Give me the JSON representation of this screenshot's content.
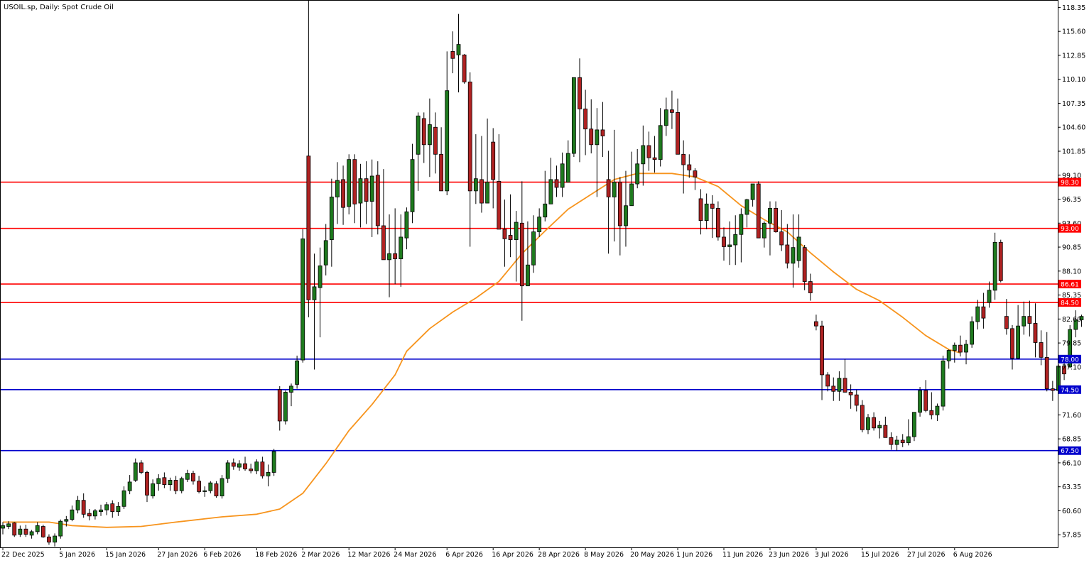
{
  "chart_title": "USOIL.sp, Daily:  Spot Crude Oil",
  "chart_data": {
    "type": "candlestick",
    "title": "USOIL.sp, Daily:  Spot Crude Oil",
    "xlabel": "",
    "ylabel": "",
    "ylim": [
      56.4,
      119.2
    ],
    "y_ticks": [
      "118.35",
      "115.60",
      "112.85",
      "110.10",
      "107.35",
      "104.60",
      "101.85",
      "99.10",
      "96.35",
      "93.60",
      "90.85",
      "88.10",
      "85.35",
      "82.60",
      "79.85",
      "77.10",
      "74.35",
      "71.60",
      "68.85",
      "66.10",
      "63.35",
      "60.60",
      "57.85"
    ],
    "x_ticks": [
      {
        "label": "22 Dec 2025",
        "index": 0
      },
      {
        "label": "5 Jan 2026",
        "index": 10
      },
      {
        "label": "15 Jan 2026",
        "index": 18
      },
      {
        "label": "27 Jan 2026",
        "index": 27
      },
      {
        "label": "6 Feb 2026",
        "index": 35
      },
      {
        "label": "18 Feb 2026",
        "index": 44
      },
      {
        "label": "2 Mar 2026",
        "index": 52
      },
      {
        "label": "12 Mar 2026",
        "index": 60
      },
      {
        "label": "24 Mar 2026",
        "index": 68
      },
      {
        "label": "6 Apr 2026",
        "index": 77
      },
      {
        "label": "16 Apr 2026",
        "index": 85
      },
      {
        "label": "28 Apr 2026",
        "index": 93
      },
      {
        "label": "8 May 2026",
        "index": 101
      },
      {
        "label": "20 May 2026",
        "index": 109
      },
      {
        "label": "1 Jun 2026",
        "index": 117
      },
      {
        "label": "11 Jun 2026",
        "index": 125
      },
      {
        "label": "23 Jun 2026",
        "index": 133
      },
      {
        "label": "3 Jul 2026",
        "index": 141
      },
      {
        "label": "15 Jul 2026",
        "index": 149
      },
      {
        "label": "27 Jul 2026",
        "index": 157
      },
      {
        "label": "6 Aug 2026",
        "index": 165
      }
    ],
    "colors": {
      "up": "#1e7a1e",
      "down": "#b02222",
      "wick": "#000000",
      "ma": "#f7941d",
      "resistance": "#ff0000",
      "support": "#0000cc",
      "grid_axis": "#000000"
    },
    "horizontal_levels": [
      {
        "value": 98.3,
        "label": "98.30",
        "kind": "resistance"
      },
      {
        "value": 93.0,
        "label": "93.00",
        "kind": "resistance"
      },
      {
        "value": 86.61,
        "label": "86.61",
        "kind": "resistance"
      },
      {
        "value": 84.5,
        "label": "84.50",
        "kind": "resistance"
      },
      {
        "value": 78.0,
        "label": "78.00",
        "kind": "support"
      },
      {
        "value": 74.5,
        "label": "74.50",
        "kind": "support"
      },
      {
        "value": 67.5,
        "label": "67.50",
        "kind": "support"
      }
    ],
    "candles": [
      [
        58.6,
        59.3,
        57.9,
        58.9
      ],
      [
        58.8,
        59.4,
        58.5,
        59.1
      ],
      [
        59.2,
        59.3,
        57.6,
        57.8
      ],
      [
        57.9,
        58.9,
        57.6,
        58.5
      ],
      [
        58.5,
        59.0,
        57.6,
        57.9
      ],
      [
        57.8,
        58.4,
        57.4,
        58.2
      ],
      [
        58.2,
        59.3,
        57.9,
        58.9
      ],
      [
        58.8,
        59.0,
        57.5,
        57.6
      ],
      [
        57.6,
        57.9,
        56.7,
        57.0
      ],
      [
        57.0,
        58.0,
        56.5,
        57.7
      ],
      [
        57.7,
        59.6,
        57.4,
        59.4
      ],
      [
        59.4,
        60.0,
        58.8,
        59.6
      ],
      [
        59.6,
        61.2,
        59.4,
        60.7
      ],
      [
        60.7,
        62.3,
        60.3,
        61.8
      ],
      [
        61.8,
        62.6,
        59.8,
        60.2
      ],
      [
        60.3,
        60.8,
        59.5,
        60.0
      ],
      [
        60.0,
        60.8,
        59.6,
        60.6
      ],
      [
        60.5,
        61.3,
        60.0,
        60.7
      ],
      [
        60.7,
        61.6,
        60.1,
        61.3
      ],
      [
        61.4,
        61.8,
        59.8,
        60.5
      ],
      [
        60.5,
        61.6,
        60.0,
        61.1
      ],
      [
        61.1,
        63.4,
        60.8,
        62.9
      ],
      [
        62.9,
        64.7,
        62.5,
        63.9
      ],
      [
        64.1,
        66.6,
        63.9,
        66.1
      ],
      [
        66.1,
        66.4,
        64.8,
        65.0
      ],
      [
        65.0,
        65.2,
        61.6,
        62.4
      ],
      [
        62.3,
        64.2,
        62.0,
        63.7
      ],
      [
        63.7,
        64.8,
        62.9,
        64.3
      ],
      [
        64.4,
        65.0,
        63.2,
        63.6
      ],
      [
        63.6,
        64.4,
        62.9,
        64.1
      ],
      [
        64.1,
        64.6,
        62.5,
        62.9
      ],
      [
        62.9,
        64.5,
        62.6,
        64.3
      ],
      [
        64.2,
        65.3,
        63.9,
        64.9
      ],
      [
        64.9,
        65.2,
        63.6,
        64.0
      ],
      [
        64.0,
        64.6,
        62.6,
        62.8
      ],
      [
        62.8,
        63.4,
        62.2,
        62.9
      ],
      [
        62.9,
        64.0,
        62.6,
        63.8
      ],
      [
        63.7,
        64.0,
        62.1,
        62.3
      ],
      [
        62.3,
        64.7,
        62.0,
        64.3
      ],
      [
        64.3,
        66.4,
        63.8,
        66.1
      ],
      [
        66.1,
        66.6,
        65.3,
        65.7
      ],
      [
        65.6,
        66.4,
        65.2,
        66.0
      ],
      [
        66.0,
        66.8,
        65.2,
        65.4
      ],
      [
        65.4,
        66.0,
        64.9,
        65.2
      ],
      [
        65.2,
        66.5,
        64.8,
        66.2
      ],
      [
        66.2,
        66.8,
        64.3,
        64.6
      ],
      [
        64.6,
        65.9,
        63.4,
        65.0
      ],
      [
        65.0,
        67.7,
        64.6,
        67.4
      ],
      [
        74.5,
        74.9,
        69.8,
        70.9
      ],
      [
        70.9,
        74.4,
        70.5,
        74.2
      ],
      [
        74.2,
        75.2,
        72.6,
        74.9
      ],
      [
        75.1,
        78.4,
        74.6,
        77.8
      ],
      [
        77.9,
        92.9,
        77.6,
        91.8
      ],
      [
        101.3,
        119.2,
        82.8,
        84.8
      ],
      [
        84.8,
        90.1,
        76.8,
        86.3
      ],
      [
        86.2,
        90.8,
        80.5,
        88.7
      ],
      [
        88.8,
        93.5,
        87.6,
        91.6
      ],
      [
        91.7,
        98.7,
        88.6,
        96.6
      ],
      [
        96.6,
        100.6,
        93.5,
        98.5
      ],
      [
        98.6,
        100.2,
        93.4,
        95.4
      ],
      [
        95.5,
        101.5,
        94.6,
        100.9
      ],
      [
        100.9,
        101.5,
        93.6,
        95.8
      ],
      [
        95.9,
        100.4,
        93.1,
        98.7
      ],
      [
        98.7,
        100.7,
        93.5,
        96.1
      ],
      [
        96.1,
        100.9,
        92.0,
        99.0
      ],
      [
        99.1,
        100.7,
        92.3,
        93.3
      ],
      [
        93.3,
        99.8,
        90.6,
        89.4
      ],
      [
        89.4,
        94.6,
        85.1,
        90.1
      ],
      [
        90.1,
        95.3,
        86.6,
        89.5
      ],
      [
        89.5,
        94.6,
        86.3,
        92.0
      ],
      [
        91.9,
        95.4,
        90.6,
        94.9
      ],
      [
        94.9,
        102.7,
        93.6,
        100.9
      ],
      [
        101.5,
        106.3,
        97.3,
        105.9
      ],
      [
        105.6,
        106.3,
        100.5,
        102.6
      ],
      [
        102.6,
        107.9,
        98.9,
        104.9
      ],
      [
        104.6,
        106.3,
        99.3,
        101.5
      ],
      [
        101.5,
        104.6,
        98.1,
        97.3
      ],
      [
        97.3,
        113.3,
        96.8,
        108.8
      ],
      [
        113.3,
        115.6,
        110.8,
        112.5
      ],
      [
        112.9,
        117.6,
        108.6,
        114.1
      ],
      [
        112.9,
        113.0,
        109.6,
        109.8
      ],
      [
        109.8,
        110.9,
        90.9,
        97.3
      ],
      [
        97.3,
        103.8,
        95.8,
        98.7
      ],
      [
        98.6,
        103.6,
        94.8,
        95.9
      ],
      [
        95.9,
        105.6,
        96.0,
        98.3
      ],
      [
        102.9,
        104.5,
        95.3,
        98.6
      ],
      [
        98.4,
        103.8,
        96.0,
        92.9
      ],
      [
        92.9,
        96.3,
        88.6,
        91.8
      ],
      [
        92.2,
        96.9,
        89.7,
        91.7
      ],
      [
        91.7,
        95.0,
        86.9,
        93.7
      ],
      [
        93.6,
        98.4,
        82.4,
        86.4
      ],
      [
        86.4,
        93.8,
        87.4,
        88.8
      ],
      [
        88.8,
        94.5,
        87.9,
        92.6
      ],
      [
        92.6,
        95.3,
        92.0,
        94.3
      ],
      [
        94.3,
        99.6,
        93.8,
        95.8
      ],
      [
        95.8,
        101.1,
        96.8,
        98.6
      ],
      [
        98.6,
        100.2,
        96.6,
        97.7
      ],
      [
        97.7,
        101.7,
        96.6,
        100.4
      ],
      [
        98.3,
        103.1,
        98.3,
        101.6
      ],
      [
        101.6,
        107.9,
        101.2,
        110.3
      ],
      [
        110.3,
        112.5,
        100.6,
        106.7
      ],
      [
        106.7,
        108.9,
        101.4,
        104.4
      ],
      [
        104.4,
        107.8,
        101.6,
        102.6
      ],
      [
        102.6,
        106.8,
        96.6,
        104.3
      ],
      [
        104.3,
        107.5,
        101.2,
        103.6
      ],
      [
        98.6,
        101.9,
        90.1,
        96.6
      ],
      [
        96.6,
        104.3,
        91.5,
        98.3
      ],
      [
        98.3,
        98.9,
        89.9,
        93.3
      ],
      [
        93.3,
        99.6,
        90.9,
        95.6
      ],
      [
        95.6,
        101.8,
        96.4,
        98.1
      ],
      [
        98.1,
        102.1,
        97.6,
        100.4
      ],
      [
        100.4,
        104.8,
        97.9,
        102.5
      ],
      [
        102.5,
        104.1,
        99.6,
        101.1
      ],
      [
        101.1,
        103.6,
        99.4,
        100.9
      ],
      [
        100.9,
        106.8,
        100.1,
        104.8
      ],
      [
        104.8,
        108.0,
        103.6,
        106.6
      ],
      [
        106.6,
        108.8,
        104.4,
        106.3
      ],
      [
        106.3,
        107.9,
        102.6,
        101.5
      ],
      [
        101.5,
        103.1,
        97.0,
        100.3
      ],
      [
        100.3,
        101.5,
        98.8,
        99.7
      ],
      [
        99.6,
        99.9,
        97.4,
        98.9
      ],
      [
        96.4,
        97.5,
        92.3,
        93.9
      ],
      [
        93.9,
        97.0,
        92.9,
        95.8
      ],
      [
        95.8,
        96.8,
        91.9,
        95.3
      ],
      [
        95.3,
        96.1,
        91.6,
        92.0
      ],
      [
        92.0,
        93.1,
        89.3,
        90.9
      ],
      [
        90.9,
        93.8,
        88.8,
        91.1
      ],
      [
        91.1,
        94.5,
        88.8,
        92.3
      ],
      [
        92.3,
        95.3,
        89.1,
        94.6
      ],
      [
        94.6,
        96.4,
        93.1,
        96.3
      ],
      [
        96.3,
        98.1,
        95.5,
        98.1
      ],
      [
        98.1,
        98.4,
        92.9,
        91.9
      ],
      [
        91.9,
        93.8,
        90.8,
        93.6
      ],
      [
        93.6,
        96.1,
        89.9,
        95.3
      ],
      [
        95.3,
        96.1,
        92.5,
        92.6
      ],
      [
        92.6,
        95.1,
        90.4,
        91.1
      ],
      [
        91.1,
        93.5,
        88.4,
        89.0
      ],
      [
        89.0,
        94.6,
        86.2,
        90.8
      ],
      [
        89.3,
        94.6,
        88.5,
        92.0
      ],
      [
        90.8,
        91.1,
        85.9,
        86.9
      ],
      [
        86.9,
        87.8,
        84.7,
        85.6
      ],
      [
        82.3,
        83.1,
        81.3,
        81.8
      ],
      [
        81.8,
        82.4,
        73.3,
        76.2
      ],
      [
        76.2,
        76.5,
        74.3,
        74.9
      ],
      [
        74.9,
        75.9,
        73.2,
        74.3
      ],
      [
        74.3,
        76.6,
        73.2,
        75.8
      ],
      [
        75.8,
        78.0,
        74.7,
        74.2
      ],
      [
        74.2,
        75.1,
        72.3,
        73.9
      ],
      [
        73.9,
        74.5,
        72.0,
        72.7
      ],
      [
        72.7,
        73.3,
        69.6,
        69.9
      ],
      [
        69.9,
        71.7,
        69.4,
        71.3
      ],
      [
        71.3,
        71.9,
        69.8,
        70.1
      ],
      [
        70.1,
        70.9,
        68.9,
        70.4
      ],
      [
        70.4,
        71.4,
        69.1,
        69.0
      ],
      [
        69.0,
        69.6,
        67.6,
        68.2
      ],
      [
        68.2,
        69.2,
        67.5,
        68.7
      ],
      [
        68.7,
        69.4,
        67.9,
        68.4
      ],
      [
        68.4,
        71.1,
        68.1,
        69.1
      ],
      [
        69.1,
        70.9,
        68.6,
        71.9
      ],
      [
        71.9,
        74.8,
        71.4,
        74.4
      ],
      [
        74.4,
        75.6,
        71.9,
        72.1
      ],
      [
        72.1,
        74.2,
        71.1,
        71.6
      ],
      [
        71.6,
        72.9,
        70.9,
        72.6
      ],
      [
        72.6,
        78.4,
        72.1,
        77.8
      ],
      [
        77.8,
        79.1,
        76.9,
        79.0
      ],
      [
        79.0,
        79.9,
        77.6,
        79.6
      ],
      [
        79.6,
        80.7,
        78.3,
        78.8
      ],
      [
        78.8,
        80.2,
        77.4,
        79.7
      ],
      [
        79.7,
        82.9,
        79.3,
        82.3
      ],
      [
        82.3,
        84.8,
        81.4,
        84.0
      ],
      [
        84.0,
        85.6,
        81.5,
        82.7
      ],
      [
        84.5,
        86.9,
        83.9,
        85.9
      ],
      [
        85.9,
        92.5,
        84.8,
        91.4
      ],
      [
        91.4,
        91.7,
        86.8,
        87.0
      ],
      [
        82.9,
        84.9,
        80.8,
        81.5
      ],
      [
        81.5,
        81.9,
        76.8,
        78.1
      ],
      [
        78.1,
        84.2,
        78.0,
        81.8
      ],
      [
        81.8,
        84.6,
        80.8,
        82.9
      ],
      [
        82.9,
        84.7,
        80.6,
        82.1
      ],
      [
        82.1,
        84.4,
        78.2,
        79.9
      ],
      [
        79.9,
        81.3,
        77.3,
        78.2
      ],
      [
        78.2,
        81.1,
        74.3,
        74.6
      ],
      [
        74.6,
        75.5,
        73.2,
        74.4
      ],
      [
        74.4,
        77.4,
        74.0,
        77.2
      ],
      [
        77.2,
        78.1,
        75.6,
        76.3
      ],
      [
        77.1,
        81.9,
        77.0,
        81.4
      ],
      [
        81.4,
        83.6,
        80.5,
        82.5
      ],
      [
        82.5,
        83.1,
        81.7,
        82.9
      ]
    ],
    "moving_average": {
      "label": "",
      "points": [
        [
          0,
          59.3
        ],
        [
          8,
          59.3
        ],
        [
          12,
          58.9
        ],
        [
          18,
          58.7
        ],
        [
          24,
          58.8
        ],
        [
          30,
          59.3
        ],
        [
          38,
          59.9
        ],
        [
          44,
          60.2
        ],
        [
          48,
          60.8
        ],
        [
          52,
          62.6
        ],
        [
          56,
          66.0
        ],
        [
          60,
          69.8
        ],
        [
          64,
          72.8
        ],
        [
          68,
          76.2
        ],
        [
          70,
          78.9
        ],
        [
          74,
          81.5
        ],
        [
          78,
          83.4
        ],
        [
          82,
          85.0
        ],
        [
          86,
          86.9
        ],
        [
          90,
          90.1
        ],
        [
          94,
          92.7
        ],
        [
          98,
          95.2
        ],
        [
          102,
          96.9
        ],
        [
          106,
          98.6
        ],
        [
          110,
          99.3
        ],
        [
          116,
          99.3
        ],
        [
          120,
          98.9
        ],
        [
          124,
          97.8
        ],
        [
          128,
          95.6
        ],
        [
          132,
          94.0
        ],
        [
          136,
          92.6
        ],
        [
          140,
          90.2
        ],
        [
          144,
          88.0
        ],
        [
          148,
          86.0
        ],
        [
          152,
          84.7
        ],
        [
          156,
          82.8
        ],
        [
          160,
          80.7
        ],
        [
          164,
          79.1
        ],
        [
          166,
          78.7
        ]
      ]
    }
  }
}
